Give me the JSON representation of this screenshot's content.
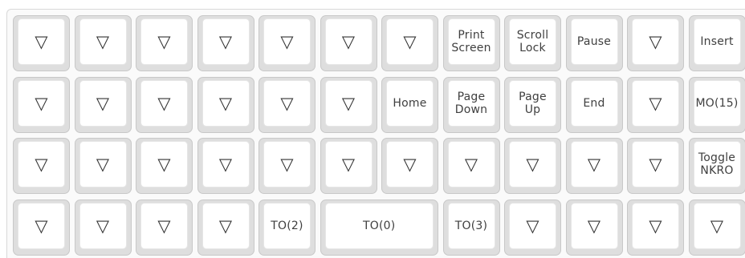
{
  "keymap": {
    "rows": [
      {
        "keys": [
          {
            "label": "▽",
            "kind": "transparent"
          },
          {
            "label": "▽",
            "kind": "transparent"
          },
          {
            "label": "▽",
            "kind": "transparent"
          },
          {
            "label": "▽",
            "kind": "transparent"
          },
          {
            "label": "▽",
            "kind": "transparent"
          },
          {
            "label": "▽",
            "kind": "transparent"
          },
          {
            "label": "▽",
            "kind": "transparent"
          },
          {
            "label": "Print\nScreen",
            "kind": "key"
          },
          {
            "label": "Scroll\nLock",
            "kind": "key"
          },
          {
            "label": "Pause",
            "kind": "key"
          },
          {
            "label": "▽",
            "kind": "transparent"
          },
          {
            "label": "Insert",
            "kind": "key"
          }
        ]
      },
      {
        "keys": [
          {
            "label": "▽",
            "kind": "transparent"
          },
          {
            "label": "▽",
            "kind": "transparent"
          },
          {
            "label": "▽",
            "kind": "transparent"
          },
          {
            "label": "▽",
            "kind": "transparent"
          },
          {
            "label": "▽",
            "kind": "transparent"
          },
          {
            "label": "▽",
            "kind": "transparent"
          },
          {
            "label": "Home",
            "kind": "key"
          },
          {
            "label": "Page\nDown",
            "kind": "key"
          },
          {
            "label": "Page\nUp",
            "kind": "key"
          },
          {
            "label": "End",
            "kind": "key"
          },
          {
            "label": "▽",
            "kind": "transparent"
          },
          {
            "label": "MO(15)",
            "kind": "key"
          }
        ]
      },
      {
        "keys": [
          {
            "label": "▽",
            "kind": "transparent"
          },
          {
            "label": "▽",
            "kind": "transparent"
          },
          {
            "label": "▽",
            "kind": "transparent"
          },
          {
            "label": "▽",
            "kind": "transparent"
          },
          {
            "label": "▽",
            "kind": "transparent"
          },
          {
            "label": "▽",
            "kind": "transparent"
          },
          {
            "label": "▽",
            "kind": "transparent"
          },
          {
            "label": "▽",
            "kind": "transparent"
          },
          {
            "label": "▽",
            "kind": "transparent"
          },
          {
            "label": "▽",
            "kind": "transparent"
          },
          {
            "label": "▽",
            "kind": "transparent"
          },
          {
            "label": "Toggle\nNKRO",
            "kind": "key"
          }
        ]
      },
      {
        "keys": [
          {
            "label": "▽",
            "kind": "transparent"
          },
          {
            "label": "▽",
            "kind": "transparent"
          },
          {
            "label": "▽",
            "kind": "transparent"
          },
          {
            "label": "▽",
            "kind": "transparent"
          },
          {
            "label": "TO(2)",
            "kind": "key"
          },
          {
            "label": "TO(0)",
            "kind": "key",
            "span": 2
          },
          {
            "label": "TO(3)",
            "kind": "key"
          },
          {
            "label": "▽",
            "kind": "transparent"
          },
          {
            "label": "▽",
            "kind": "transparent"
          },
          {
            "label": "▽",
            "kind": "transparent"
          },
          {
            "label": "▽",
            "kind": "transparent"
          }
        ]
      }
    ]
  }
}
